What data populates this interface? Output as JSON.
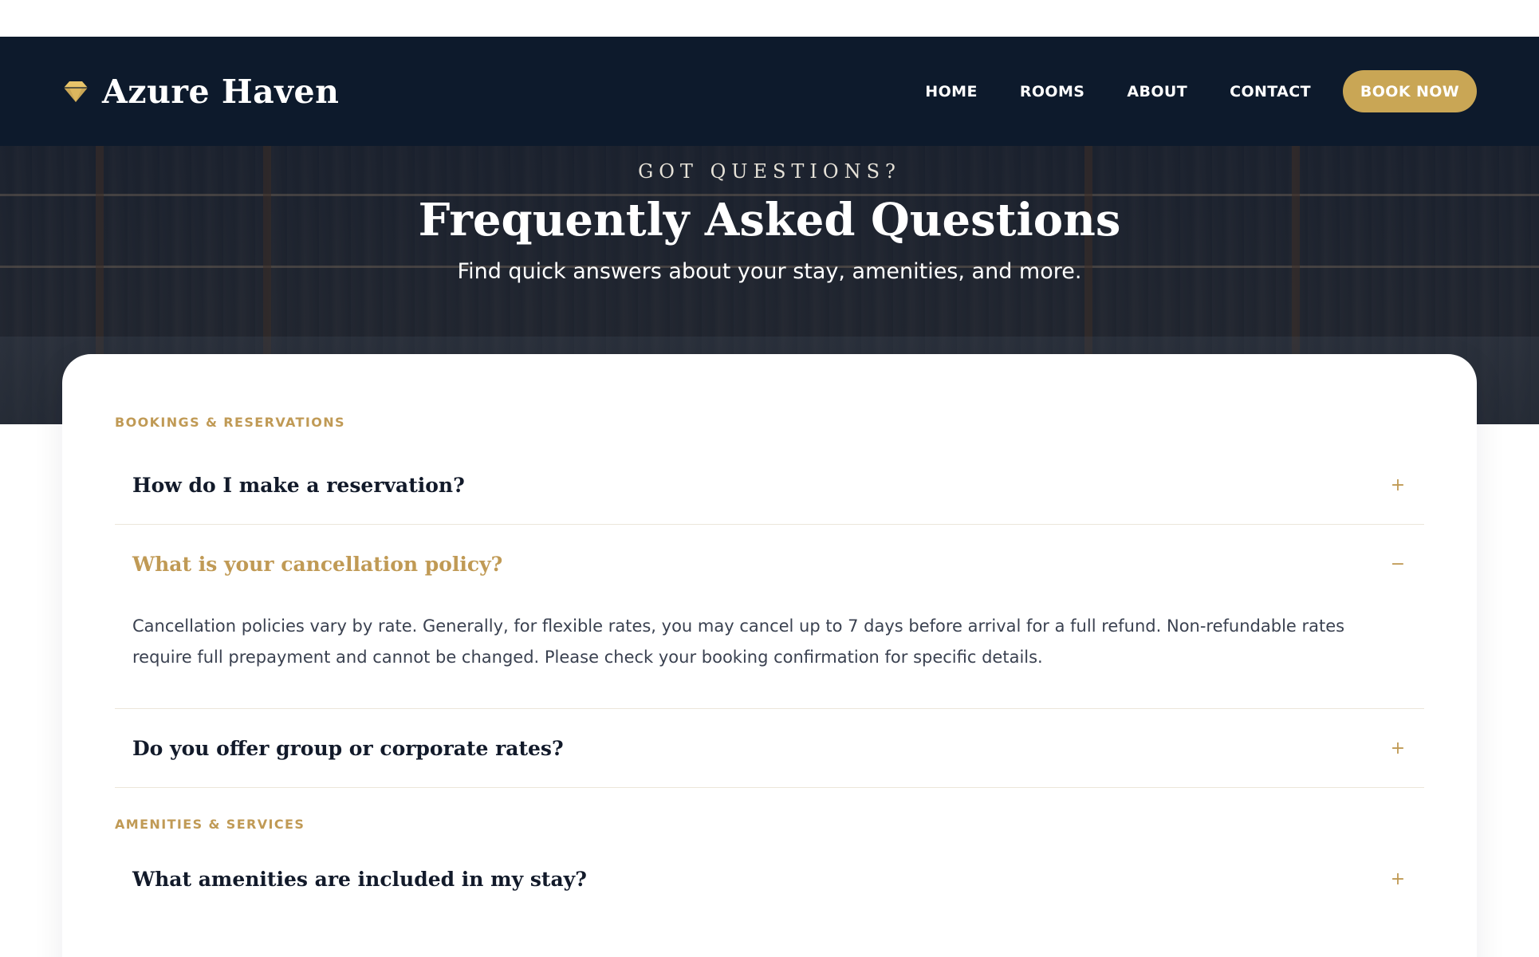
{
  "brand": {
    "name": "Azure Haven",
    "icon": "diamond-icon",
    "accent": "#c9a655"
  },
  "nav": {
    "links": [
      "HOME",
      "ROOMS",
      "ABOUT",
      "CONTACT"
    ],
    "cta": "BOOK NOW"
  },
  "hero": {
    "eyebrow": "GOT QUESTIONS?",
    "title": "Frequently Asked Questions",
    "subtitle": "Find quick answers about your stay, amenities, and more."
  },
  "sections": [
    {
      "label": "BOOKINGS & RESERVATIONS",
      "items": [
        {
          "question": "How do I make a reservation?",
          "toggle": "+",
          "open": false
        },
        {
          "question": "What is your cancellation policy?",
          "toggle": "−",
          "open": true,
          "answer": "Cancellation policies vary by rate. Generally, for flexible rates, you may cancel up to 7 days before arrival for a full refund. Non-refundable rates require full prepayment and cannot be changed. Please check your booking confirmation for specific details."
        },
        {
          "question": "Do you offer group or corporate rates?",
          "toggle": "+",
          "open": false
        }
      ]
    },
    {
      "label": "AMENITIES & SERVICES",
      "items": [
        {
          "question": "What amenities are included in my stay?",
          "toggle": "+",
          "open": false
        }
      ]
    }
  ],
  "colors": {
    "header_bg": "#0d1a2c",
    "gold": "#c09a55",
    "question_text": "#121a2a",
    "answer_text": "#3a4150"
  }
}
